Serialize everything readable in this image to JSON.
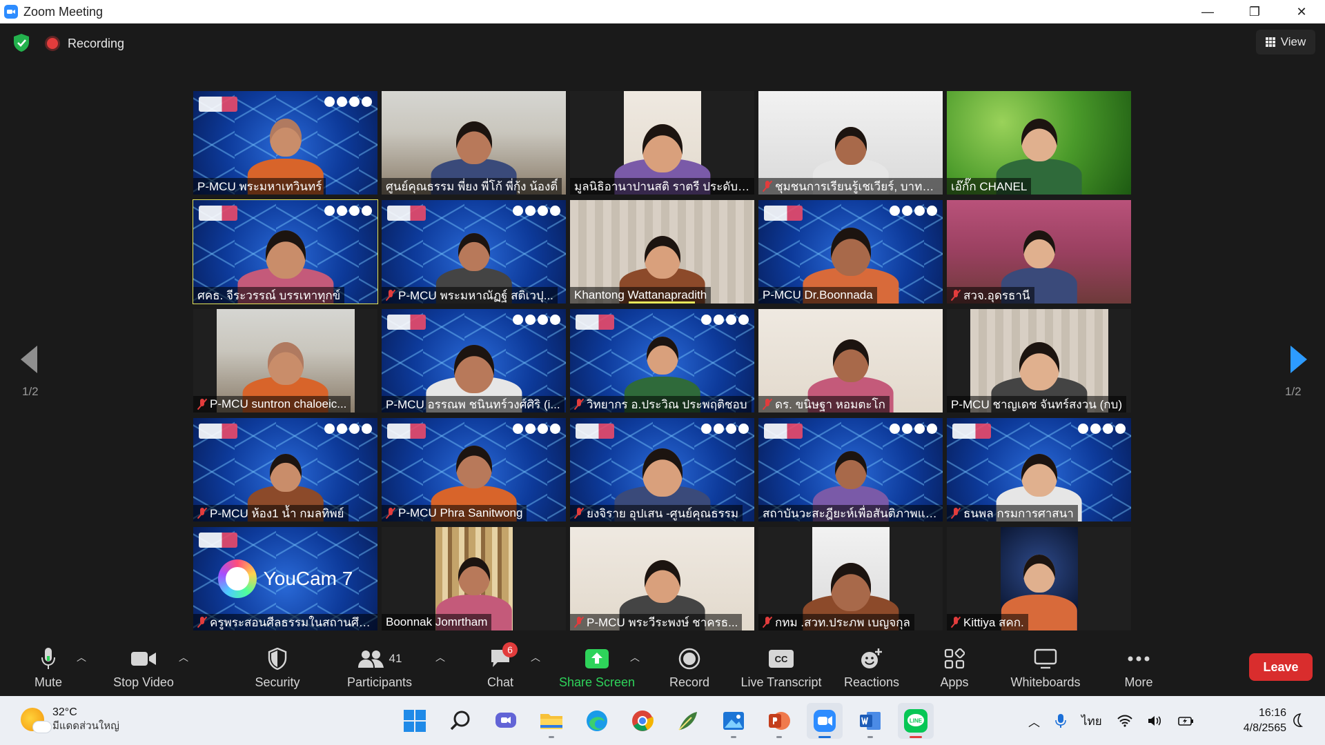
{
  "window": {
    "title": "Zoom Meeting",
    "minimize": "—",
    "restore": "❐",
    "close": "✕"
  },
  "topbar": {
    "recording_label": "Recording",
    "view_label": "View",
    "page_left": "1/2",
    "page_right": "1/2"
  },
  "participants": [
    {
      "name": "P-MCU พระมหาเทวินทร์",
      "muted": false,
      "bg": "virtual"
    },
    {
      "name": "ศูนย์คุณธรรม พี่ยง พี่โก้ พี่กุ้ง น้องติ์",
      "muted": false,
      "bg": "office"
    },
    {
      "name": "มูลนิธิอานาปานสติ ราตรี ประดับด...",
      "muted": false,
      "bg": "white-wall"
    },
    {
      "name": "ชุมชนการเรียนรู้เชเวียร์, บาทห...",
      "muted": true,
      "bg": "ceiling"
    },
    {
      "name": "เอ๊กั๊ก CHANEL",
      "muted": false,
      "bg": "green"
    },
    {
      "name": "ศคธ. จีระวรรณ์ บรรเทาทุกข์",
      "muted": false,
      "bg": "virtual",
      "active": true
    },
    {
      "name": "P-MCU พระมหาณัฏฐ์ สติเวปุ...",
      "muted": true,
      "bg": "virtual"
    },
    {
      "name": "Khantong Wattanapradith",
      "muted": false,
      "bg": "curtain",
      "speaking": true
    },
    {
      "name": "P-MCU Dr.Boonnada",
      "muted": false,
      "bg": "virtual"
    },
    {
      "name": "สวจ.อุดรธานี",
      "muted": true,
      "bg": "pink-room"
    },
    {
      "name": "P-MCU suntron chaloeic...",
      "muted": true,
      "bg": "office"
    },
    {
      "name": "P-MCU อรรณพ ชนินทร์วงศ์ศิริ (i...",
      "muted": false,
      "bg": "virtual"
    },
    {
      "name": "วิทยากร อ.ประวิณ ประพฤติชอบ",
      "muted": true,
      "bg": "virtual"
    },
    {
      "name": "ดร. ขนิษฐา หอมตะโก",
      "muted": true,
      "bg": "white-wall"
    },
    {
      "name": "P-MCU ชาญเดช จันทร์สงวน (กบ)",
      "muted": false,
      "bg": "curtain"
    },
    {
      "name": "P-MCU ห้อง1 น้ำ กมลทิพย์",
      "muted": true,
      "bg": "virtual"
    },
    {
      "name": "P-MCU Phra Sanitwong",
      "muted": true,
      "bg": "virtual"
    },
    {
      "name": "ยงจิราย อุปเสน -ศูนย์คุณธรรม",
      "muted": true,
      "bg": "virtual"
    },
    {
      "name": "สถาบันวะสะฎียะห์เพื่อสันติภาพแล...",
      "muted": false,
      "bg": "virtual"
    },
    {
      "name": "ธนพล กรมการศาสนา",
      "muted": true,
      "bg": "virtual"
    },
    {
      "name": "ครูพระสอนศีลธรรมในสถานศึก...",
      "muted": true,
      "bg": "youcam",
      "youcam_text": "YouCam 7"
    },
    {
      "name": "Boonnak Jomrtham",
      "muted": false,
      "bg": "bookshelf"
    },
    {
      "name": "P-MCU พระวีระพงษ์ ชาครธ...",
      "muted": true,
      "bg": "white-wall"
    },
    {
      "name": "กทม .สวท.ประภพ เบญจกุล",
      "muted": true,
      "bg": "ceiling"
    },
    {
      "name": "Kittiya สคก.",
      "muted": true,
      "bg": "space"
    }
  ],
  "controls": {
    "mute": "Mute",
    "stop_video": "Stop Video",
    "security": "Security",
    "participants": "Participants",
    "participants_count": "41",
    "chat": "Chat",
    "chat_badge": "6",
    "share_screen": "Share Screen",
    "record": "Record",
    "live_transcript": "Live Transcript",
    "cc_icon_text": "CC",
    "reactions": "Reactions",
    "apps": "Apps",
    "whiteboards": "Whiteboards",
    "more": "More",
    "leave": "Leave"
  },
  "taskbar": {
    "temperature": "32°C",
    "weather_desc": "มีแดดส่วนใหญ่",
    "language": "ไทย",
    "time": "16:16",
    "date": "4/8/2565",
    "line_label": "LINE"
  },
  "colors": {
    "zoom_blue": "#2d8cff",
    "share_green": "#2ed35a",
    "leave_red": "#d92d2d",
    "active_speaker": "#e8e85a"
  }
}
